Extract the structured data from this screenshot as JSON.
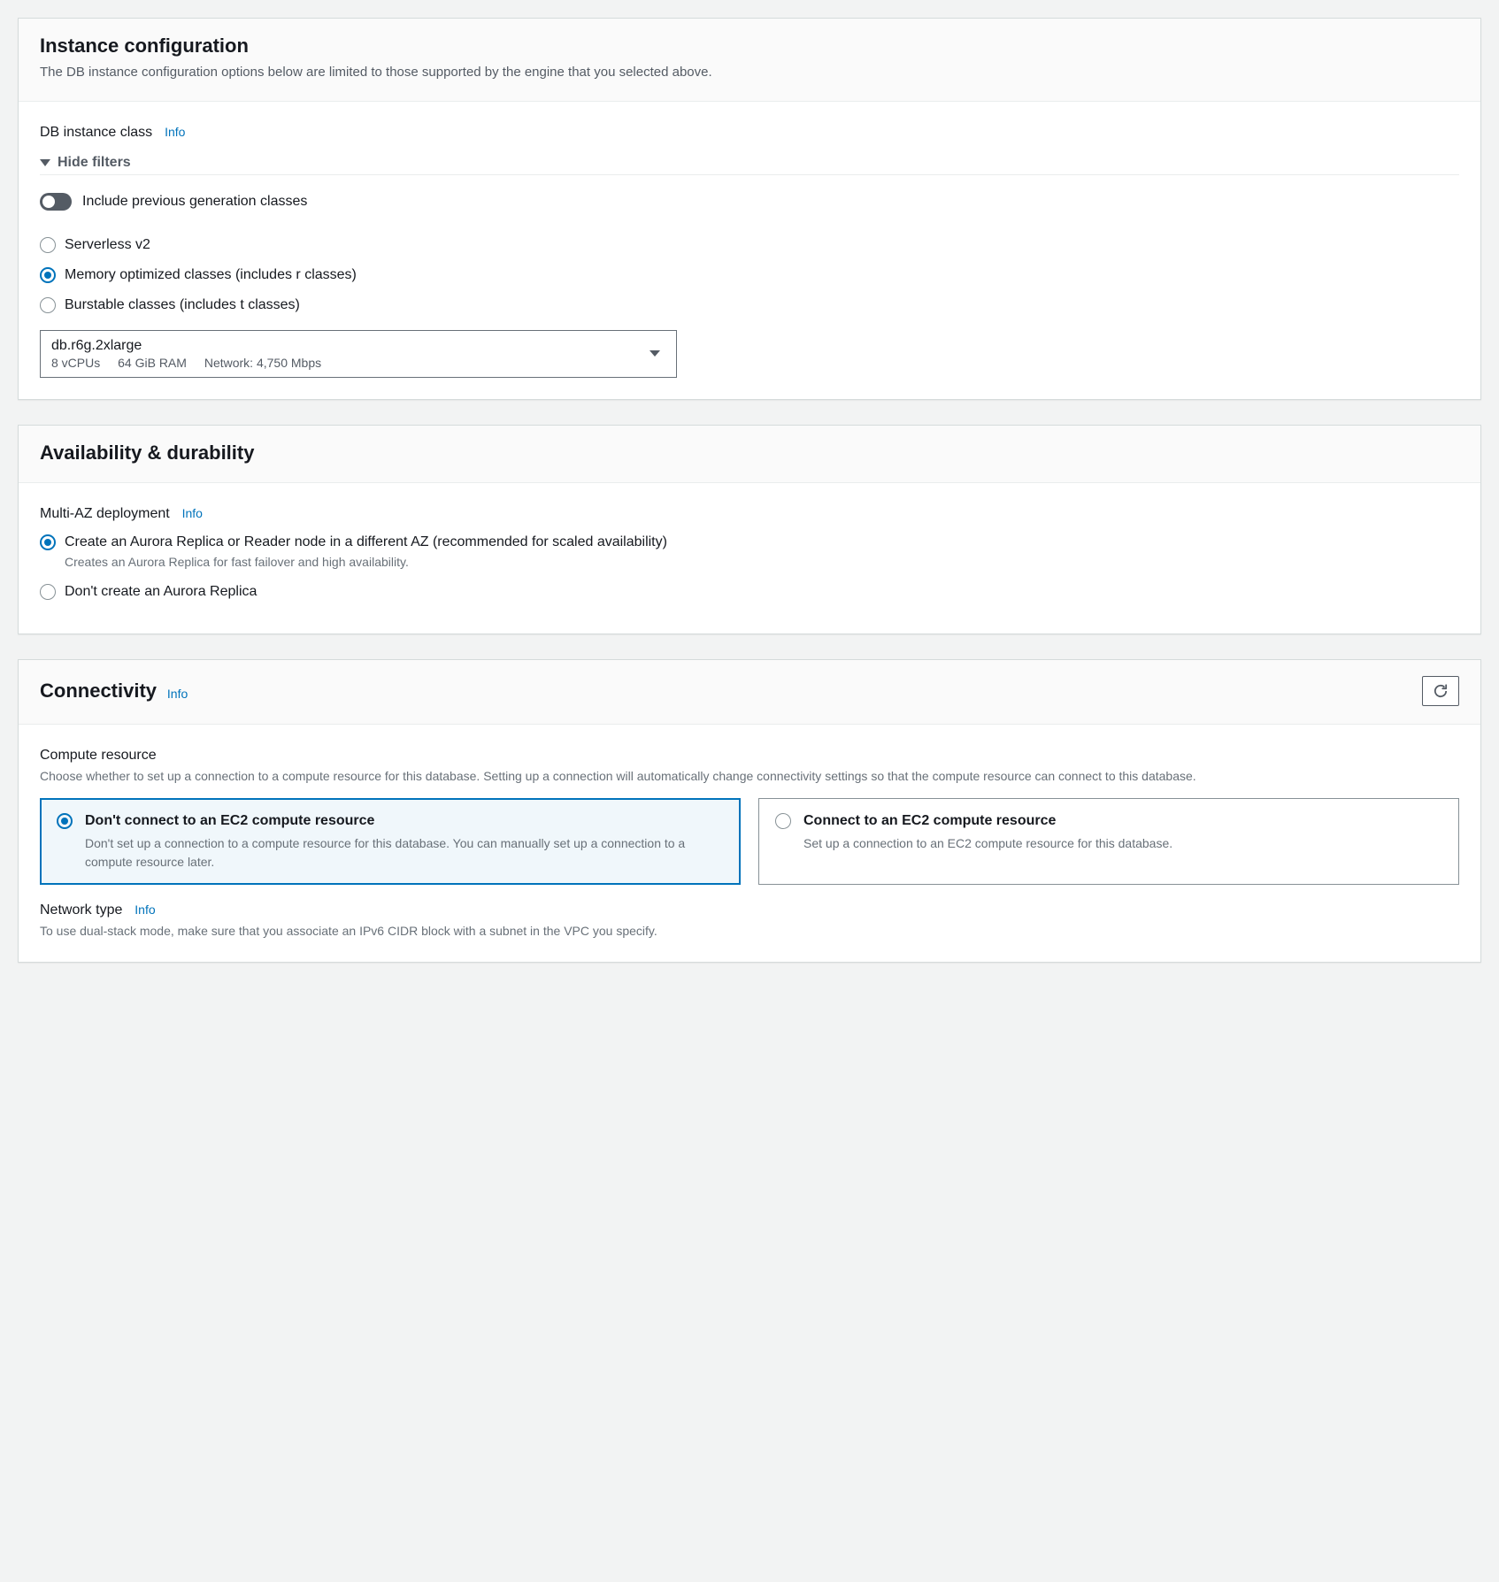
{
  "common": {
    "info": "Info"
  },
  "instance": {
    "title": "Instance configuration",
    "desc": "The DB instance configuration options below are limited to those supported by the engine that you selected above.",
    "classLabel": "DB instance class",
    "hideFilters": "Hide filters",
    "toggleLabel": "Include previous generation classes",
    "radios": {
      "serverless": "Serverless v2",
      "memory": "Memory optimized classes (includes r classes)",
      "burstable": "Burstable classes (includes t classes)"
    },
    "selectedInstance": {
      "name": "db.r6g.2xlarge",
      "vcpu": "8 vCPUs",
      "ram": "64 GiB RAM",
      "network": "Network: 4,750 Mbps"
    }
  },
  "availability": {
    "title": "Availability & durability",
    "multiAzLabel": "Multi-AZ deployment",
    "radios": {
      "create": {
        "label": "Create an Aurora Replica or Reader node in a different AZ (recommended for scaled availability)",
        "desc": "Creates an Aurora Replica for fast failover and high availability."
      },
      "dont": {
        "label": "Don't create an Aurora Replica"
      }
    }
  },
  "connectivity": {
    "title": "Connectivity",
    "compute": {
      "label": "Compute resource",
      "desc": "Choose whether to set up a connection to a compute resource for this database. Setting up a connection will automatically change connectivity settings so that the compute resource can connect to this database.",
      "tiles": {
        "dont": {
          "title": "Don't connect to an EC2 compute resource",
          "desc": "Don't set up a connection to a compute resource for this database. You can manually set up a connection to a compute resource later."
        },
        "connect": {
          "title": "Connect to an EC2 compute resource",
          "desc": "Set up a connection to an EC2 compute resource for this database."
        }
      }
    },
    "network": {
      "label": "Network type",
      "desc": "To use dual-stack mode, make sure that you associate an IPv6 CIDR block with a subnet in the VPC you specify."
    }
  }
}
